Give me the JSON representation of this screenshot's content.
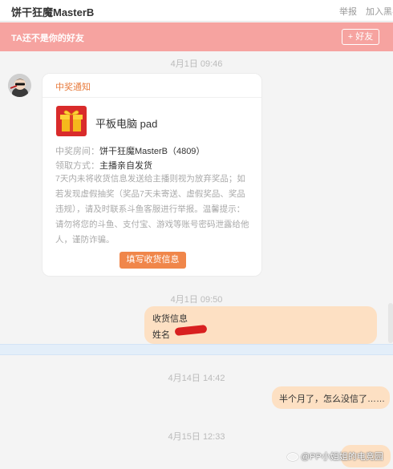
{
  "header": {
    "title": "饼干狂魔MasterB",
    "report_label": "举报",
    "block_label": "加入黑名单"
  },
  "banner": {
    "text": "TA还不是你的好友",
    "add_friend_label": "+ 好友"
  },
  "timestamps": {
    "t1": "4月1日 09:46",
    "t2": "4月1日 09:50",
    "t3": "4月14日 14:42",
    "t4": "4月15日 12:33"
  },
  "prize_card": {
    "header": "中奖通知",
    "prize_name": "平板电脑 pad",
    "room_label": "中奖房间：",
    "room_value": "饼干狂魔MasterB（4809）",
    "method_label": "领取方式：",
    "method_value": "主播亲自发货",
    "notice": "7天内未将收货信息发送给主播则视为放弃奖品；如若发现虚假抽奖（奖品7天未寄送、虚假奖品、奖品违规），请及时联系斗鱼客服进行举报。温馨提示：请勿将您的斗鱼、支付宝、游戏等账号密码泄露给他人，谨防诈骗。",
    "fill_button": "填写收货信息"
  },
  "messages": {
    "shipping_line1": "收货信息",
    "shipping_line2": "姓名",
    "followup": "半个月了，怎么没信了……"
  },
  "watermark": "@PP小姐姐的电竞园",
  "colors": {
    "banner": "#f6a3a0",
    "accent": "#f0864a",
    "bubble": "#fde0c3",
    "gift": "#d92b2b"
  }
}
